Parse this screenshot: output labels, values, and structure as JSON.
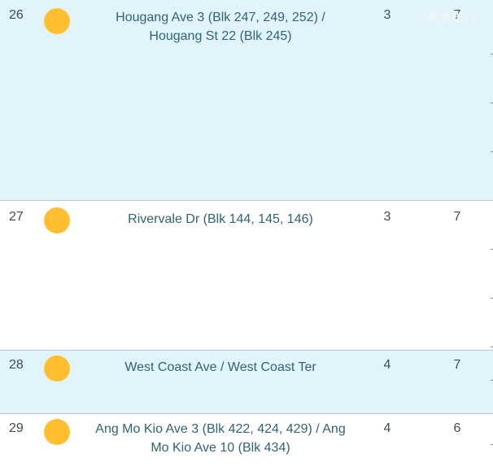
{
  "watermark": "滴滴出行",
  "rows": [
    {
      "number": "26",
      "location": "Hougang Ave 3 (Blk 247, 249, 252) / Hougang St 22 (Blk 245)",
      "col_a": "3",
      "col_b": "7",
      "status_color": "#ffbf2e",
      "background": "#e2f4fb"
    },
    {
      "number": "27",
      "location": "Rivervale Dr (Blk 144, 145, 146)",
      "col_a": "3",
      "col_b": "7",
      "status_color": "#ffbf2e",
      "background": "#ffffff"
    },
    {
      "number": "28",
      "location": "West Coast Ave / West Coast Ter",
      "col_a": "4",
      "col_b": "7",
      "status_color": "#ffbf2e",
      "background": "#e2f4fb"
    },
    {
      "number": "29",
      "location": "Ang Mo Kio Ave 3 (Blk 422, 424, 429) / Ang Mo Kio Ave 10 (Blk 434)",
      "col_a": "4",
      "col_b": "6",
      "status_color": "#ffbf2e",
      "background": "#ffffff"
    }
  ]
}
